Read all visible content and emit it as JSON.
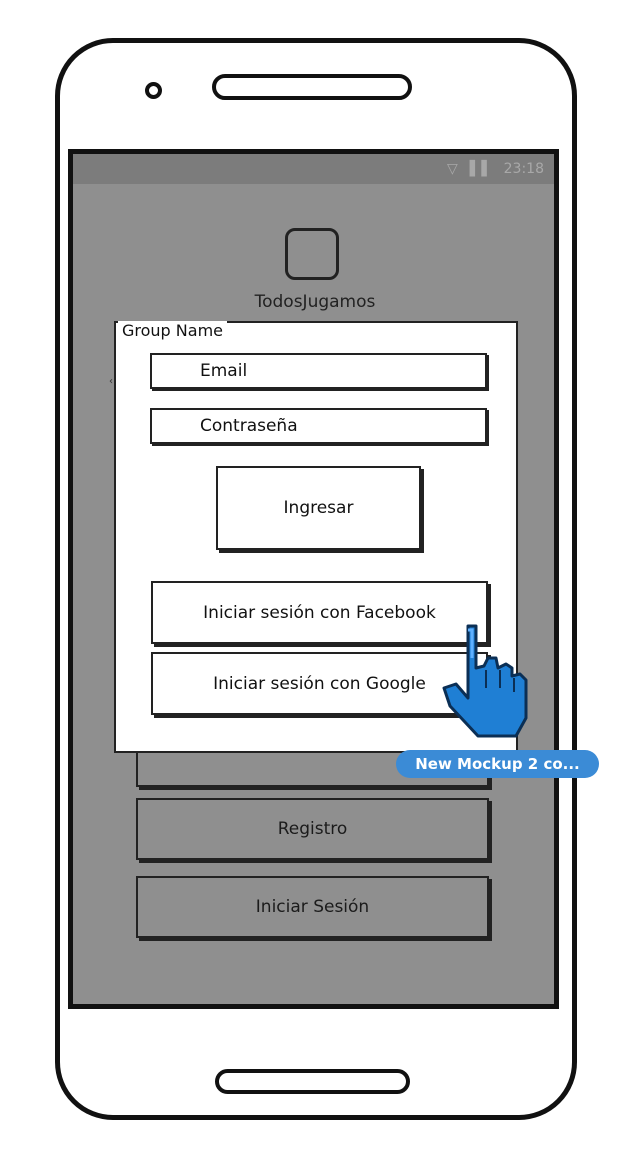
{
  "status_bar": {
    "time": "23:18",
    "icons": [
      "wifi-icon",
      "signal-icon",
      "battery-icon"
    ]
  },
  "app": {
    "title": "TodosJugamos"
  },
  "login_group": {
    "legend": "Group Name",
    "email_placeholder": "Email",
    "password_placeholder": "Contraseña",
    "submit_label": "Ingresar",
    "facebook_label": "Iniciar sesión con Facebook",
    "google_label": "Iniciar sesión con Google"
  },
  "background_buttons": {
    "register_label": "Registro",
    "login_label": "Iniciar Sesión"
  },
  "link_tooltip": "New Mockup 2 co...",
  "colors": {
    "screen": "#8f8f8f",
    "tooltip": "#3b8bd6",
    "cursor": "#1f7fd4"
  }
}
